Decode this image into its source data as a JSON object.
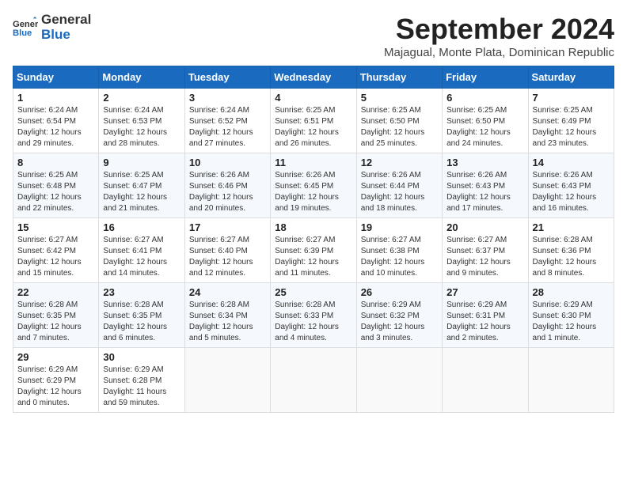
{
  "logo": {
    "line1": "General",
    "line2": "Blue"
  },
  "title": "September 2024",
  "subtitle": "Majagual, Monte Plata, Dominican Republic",
  "days_of_week": [
    "Sunday",
    "Monday",
    "Tuesday",
    "Wednesday",
    "Thursday",
    "Friday",
    "Saturday"
  ],
  "weeks": [
    [
      {
        "day": "1",
        "sunrise": "6:24 AM",
        "sunset": "6:54 PM",
        "daylight": "12 hours and 29 minutes."
      },
      {
        "day": "2",
        "sunrise": "6:24 AM",
        "sunset": "6:53 PM",
        "daylight": "12 hours and 28 minutes."
      },
      {
        "day": "3",
        "sunrise": "6:24 AM",
        "sunset": "6:52 PM",
        "daylight": "12 hours and 27 minutes."
      },
      {
        "day": "4",
        "sunrise": "6:25 AM",
        "sunset": "6:51 PM",
        "daylight": "12 hours and 26 minutes."
      },
      {
        "day": "5",
        "sunrise": "6:25 AM",
        "sunset": "6:50 PM",
        "daylight": "12 hours and 25 minutes."
      },
      {
        "day": "6",
        "sunrise": "6:25 AM",
        "sunset": "6:50 PM",
        "daylight": "12 hours and 24 minutes."
      },
      {
        "day": "7",
        "sunrise": "6:25 AM",
        "sunset": "6:49 PM",
        "daylight": "12 hours and 23 minutes."
      }
    ],
    [
      {
        "day": "8",
        "sunrise": "6:25 AM",
        "sunset": "6:48 PM",
        "daylight": "12 hours and 22 minutes."
      },
      {
        "day": "9",
        "sunrise": "6:25 AM",
        "sunset": "6:47 PM",
        "daylight": "12 hours and 21 minutes."
      },
      {
        "day": "10",
        "sunrise": "6:26 AM",
        "sunset": "6:46 PM",
        "daylight": "12 hours and 20 minutes."
      },
      {
        "day": "11",
        "sunrise": "6:26 AM",
        "sunset": "6:45 PM",
        "daylight": "12 hours and 19 minutes."
      },
      {
        "day": "12",
        "sunrise": "6:26 AM",
        "sunset": "6:44 PM",
        "daylight": "12 hours and 18 minutes."
      },
      {
        "day": "13",
        "sunrise": "6:26 AM",
        "sunset": "6:43 PM",
        "daylight": "12 hours and 17 minutes."
      },
      {
        "day": "14",
        "sunrise": "6:26 AM",
        "sunset": "6:43 PM",
        "daylight": "12 hours and 16 minutes."
      }
    ],
    [
      {
        "day": "15",
        "sunrise": "6:27 AM",
        "sunset": "6:42 PM",
        "daylight": "12 hours and 15 minutes."
      },
      {
        "day": "16",
        "sunrise": "6:27 AM",
        "sunset": "6:41 PM",
        "daylight": "12 hours and 14 minutes."
      },
      {
        "day": "17",
        "sunrise": "6:27 AM",
        "sunset": "6:40 PM",
        "daylight": "12 hours and 12 minutes."
      },
      {
        "day": "18",
        "sunrise": "6:27 AM",
        "sunset": "6:39 PM",
        "daylight": "12 hours and 11 minutes."
      },
      {
        "day": "19",
        "sunrise": "6:27 AM",
        "sunset": "6:38 PM",
        "daylight": "12 hours and 10 minutes."
      },
      {
        "day": "20",
        "sunrise": "6:27 AM",
        "sunset": "6:37 PM",
        "daylight": "12 hours and 9 minutes."
      },
      {
        "day": "21",
        "sunrise": "6:28 AM",
        "sunset": "6:36 PM",
        "daylight": "12 hours and 8 minutes."
      }
    ],
    [
      {
        "day": "22",
        "sunrise": "6:28 AM",
        "sunset": "6:35 PM",
        "daylight": "12 hours and 7 minutes."
      },
      {
        "day": "23",
        "sunrise": "6:28 AM",
        "sunset": "6:35 PM",
        "daylight": "12 hours and 6 minutes."
      },
      {
        "day": "24",
        "sunrise": "6:28 AM",
        "sunset": "6:34 PM",
        "daylight": "12 hours and 5 minutes."
      },
      {
        "day": "25",
        "sunrise": "6:28 AM",
        "sunset": "6:33 PM",
        "daylight": "12 hours and 4 minutes."
      },
      {
        "day": "26",
        "sunrise": "6:29 AM",
        "sunset": "6:32 PM",
        "daylight": "12 hours and 3 minutes."
      },
      {
        "day": "27",
        "sunrise": "6:29 AM",
        "sunset": "6:31 PM",
        "daylight": "12 hours and 2 minutes."
      },
      {
        "day": "28",
        "sunrise": "6:29 AM",
        "sunset": "6:30 PM",
        "daylight": "12 hours and 1 minute."
      }
    ],
    [
      {
        "day": "29",
        "sunrise": "6:29 AM",
        "sunset": "6:29 PM",
        "daylight": "12 hours and 0 minutes."
      },
      {
        "day": "30",
        "sunrise": "6:29 AM",
        "sunset": "6:28 PM",
        "daylight": "11 hours and 59 minutes."
      },
      null,
      null,
      null,
      null,
      null
    ]
  ],
  "labels": {
    "sunrise": "Sunrise:",
    "sunset": "Sunset:",
    "daylight": "Daylight:"
  }
}
